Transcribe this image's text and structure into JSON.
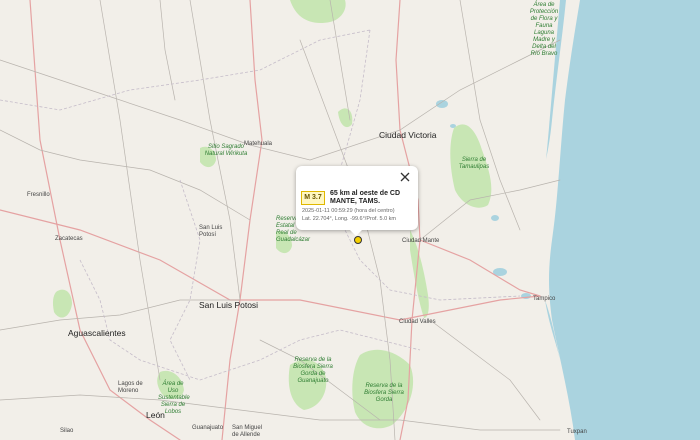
{
  "map": {
    "cities": [
      {
        "key": "ciudad_victoria",
        "name": "Ciudad Victoria"
      },
      {
        "key": "ciudad_mante",
        "name": "Ciudad Mante"
      },
      {
        "key": "tampico",
        "name": "Tampico"
      },
      {
        "key": "ciudad_valles",
        "name": "Ciudad Valles"
      },
      {
        "key": "san_luis_potosi",
        "name": "San Luis Potosi"
      },
      {
        "key": "aguascalientes",
        "name": "Aguascalientes"
      },
      {
        "key": "leon",
        "name": "León"
      },
      {
        "key": "matehuala",
        "name": "Matehuala"
      },
      {
        "key": "fresnillo",
        "name": "Fresnillo"
      },
      {
        "key": "zacatecas",
        "name": "Zacatecas"
      },
      {
        "key": "lagos_de_moreno",
        "name": "Lagos de Moreno"
      },
      {
        "key": "guanajuato",
        "name": "Guanajuato"
      },
      {
        "key": "san_luis_potosi_small",
        "name": "San Luis Potosí"
      },
      {
        "key": "san_miguel",
        "name": "San Miguel de Allende"
      },
      {
        "key": "silao",
        "name": "Silao"
      },
      {
        "key": "tuxpan",
        "name": "Tuxpan"
      }
    ],
    "areas": {
      "wirikuta": "Sitio Sagrado Natural Wirikuta",
      "sierra_tamaulipas": "Sierra de Tamaulipas",
      "reserva_guadalcazar": "Reserva Estatal Real de Guadalcázar",
      "sierra_gorda_gto": "Reserva de la Biosfera Sierra Gorda de Guanajuato",
      "sierra_gorda": "Reserva de la Biosfera Sierra Gorda",
      "sierra_lobos": "Área de Uso Sustentable Sierra de Lobos",
      "laguna_madre": "Área de Protección de Flora y Fauna Laguna Madre y Delta del Río Bravo"
    }
  },
  "popup": {
    "magnitude": "M 3.7",
    "place": "65 km al oeste de CD MANTE, TAMS.",
    "datetime": "2025-01-11    00:59:29 (hora del centro)",
    "coords": "Lat. 22.704°, Long. -99.6°/Prof. 5.0 km",
    "close_icon": "close-icon"
  },
  "colors": {
    "land": "#f2efe9",
    "sea": "#aad3df",
    "park": "#c8e6b4",
    "marker": "#f5d000"
  }
}
